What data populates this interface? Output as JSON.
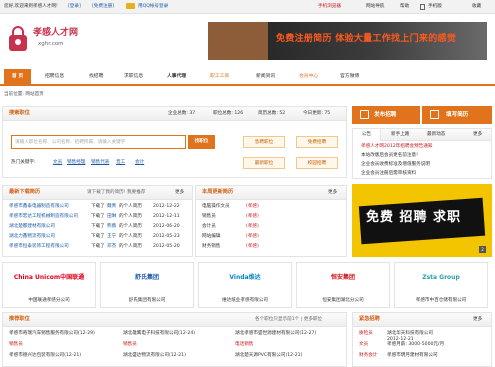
{
  "topbar": {
    "welcome": "您好,欢迎来到孝感人才网!",
    "login": "[登录]",
    "register": "[免费注册]",
    "qq_login": "用QQ帐号登录",
    "phone": "手机浏览器",
    "sitemap": "网站导航",
    "help": "帮助",
    "mobile": "手机版",
    "favorite": "收藏"
  },
  "logo": {
    "name": "孝感人才网",
    "domain": "xghr.com"
  },
  "banner": {
    "text": "免费注册简历 体验大量工作找上门来的感觉"
  },
  "nav": {
    "items": [
      "首 页",
      "招聘信息",
      "找招聘",
      "求职信息",
      "人事代理",
      "职工工资",
      "新闻资讯",
      "会员中心",
      "官方微博"
    ]
  },
  "breadcrumb": "当前位置: 网站首页",
  "search": {
    "title": "搜索职位",
    "stats": [
      "企业总数: 37",
      "职位总数: 126",
      "简历总数: 52",
      "今日更新: 75"
    ],
    "placeholder": "请输入职位名称、公司名称、招聘所属、请输入关键字",
    "button": "找职位",
    "hot_label": "热门关键字:",
    "hot": [
      "文员",
      "销售经理",
      "销售代表",
      "普工",
      "会计"
    ],
    "quick": [
      "急聘职位",
      "免费招聘",
      "最新职位",
      "校园招聘"
    ]
  },
  "actions": {
    "post_job": "发布招聘",
    "fill_resume": "填写简历"
  },
  "notice": {
    "tabs": [
      "公告",
      "新手上路",
      "最新动态"
    ],
    "more": "更多",
    "items": [
      "孝感人才网2012年招聘会预告通知",
      "本站改版后会员更名前注意!",
      "企业会员收费标准及增值服务说明",
      "企业会员注册后需审核资料"
    ]
  },
  "latest_jobs": {
    "title": "最新下载简历",
    "sub": "请下载了我的简历! 我要推荐",
    "more": "更多",
    "rows": [
      {
        "company": "孝感市鑫泰电器制造有限公司",
        "act": "下载了",
        "name": "魏青",
        "tail": "的个人简历",
        "date": "2012-12-22"
      },
      {
        "company": "孝感市宏达工程机械制造有限公司",
        "act": "下载了",
        "name": "田琳",
        "tail": "的个人简历",
        "date": "2012-12-11"
      },
      {
        "company": "湖北楚都建材有限公司",
        "act": "下载了",
        "name": "熊薇",
        "tail": "的个人简历",
        "date": "2012-06-20"
      },
      {
        "company": "湖北力鑫物流有限公司",
        "act": "下载了",
        "name": "王宁",
        "tail": "的个人简历",
        "date": "2012-05-23"
      },
      {
        "company": "孝感市恒泰装饰工程有限公司",
        "act": "下载了",
        "name": "邓杰",
        "tail": "的个人简历",
        "date": "2012-05-20"
      }
    ]
  },
  "latest_resumes": {
    "title": "本周更新简历",
    "more": "更多",
    "rows": [
      {
        "job": "电脑操作文员",
        "tag": "(孝感)"
      },
      {
        "job": "销售员",
        "tag": "(孝感)"
      },
      {
        "job": "会计员",
        "tag": "(孝感)"
      },
      {
        "job": "网站编辑",
        "tag": "(孝感)"
      },
      {
        "job": "财务销售",
        "tag": "(孝感)"
      }
    ]
  },
  "ad_right": {
    "text": "免费 招聘 求职"
  },
  "logos": [
    {
      "name": "China Unicom中国联通",
      "caption": "中国联通孝感分公司"
    },
    {
      "name": "舒氏集团",
      "caption": "舒氏集团有限公司"
    },
    {
      "name": "Vinda维达",
      "caption": "维达纸业孝感有限公司"
    },
    {
      "name": "恒安集团",
      "caption": "恒安集团湖北分公司"
    },
    {
      "name": "Zsta Group",
      "caption": "孝感市中百仓储有限公司"
    }
  ],
  "recommend": {
    "title": "推荐职位",
    "sub": "各个职位只显示前1个 | 更多职位",
    "rows": [
      {
        "a": "孝感市奇瑞汽车销售服务有限公司(12-29)",
        "b": "湖北雄鹰电子科技有限公司(12-24)",
        "c": "湖北孝感市盛世源建材有限公司(12-27)"
      },
      {
        "a": "销售员",
        "b": "销售员",
        "c": "电话销售"
      },
      {
        "a": "孝感市德兴达包装有限公司(12-21)",
        "b": "湖北盛达物流有限公司(12-21)",
        "c": "湖北楚天源PVC有限公司(12-21)"
      }
    ]
  },
  "urgent": {
    "title": "紧急招聘",
    "more": "更多",
    "rows": [
      {
        "job": "质检员",
        "co": "湖北华天科技有限公司",
        "date": "2012-12-21"
      },
      {
        "job": "文员",
        "co": "孝感月薪: 3000-5000元/月"
      },
      {
        "job": "财务会计",
        "co": "孝感市明月建材有限公司"
      }
    ]
  }
}
